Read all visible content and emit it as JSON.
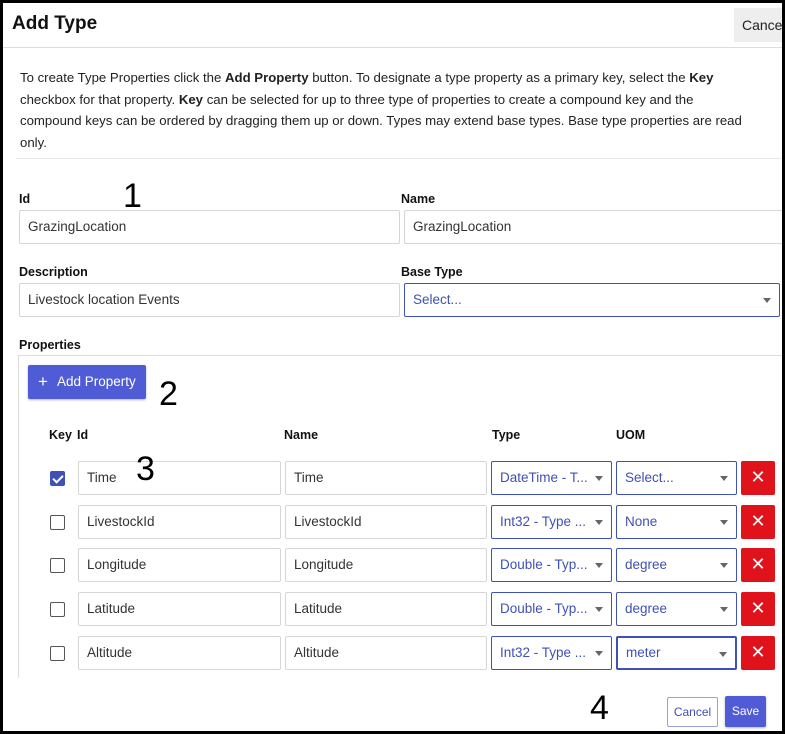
{
  "dialog": {
    "title": "Add Type",
    "cancel_top_label": "Cancel",
    "intro": {
      "p1": "To create Type Properties click the ",
      "b1": "Add Property",
      "p2": " button. To designate a type property as a primary key, select the ",
      "b2": "Key",
      "p3": " checkbox for that property. ",
      "b3": "Key",
      "p4": " can be selected for up to three type of properties to create a compound key and the compound keys can be ordered by dragging them up or down. Types may extend base types. Base type properties are read only."
    }
  },
  "form": {
    "id_label": "Id",
    "id_value": "GrazingLocation",
    "name_label": "Name",
    "name_value": "GrazingLocation",
    "description_label": "Description",
    "description_value": "Livestock location Events",
    "base_type_label": "Base Type",
    "base_type_value": "Select..."
  },
  "properties": {
    "section_label": "Properties",
    "add_button_label": "Add Property",
    "add_button_icon": "plus-icon",
    "columns": {
      "key": "Key",
      "id": "Id",
      "name": "Name",
      "type": "Type",
      "uom": "UOM"
    },
    "rows": [
      {
        "key": true,
        "id": "Time",
        "name": "Time",
        "type": "DateTime - T...",
        "uom": "Select..."
      },
      {
        "key": false,
        "id": "LivestockId",
        "name": "LivestockId",
        "type": "Int32 - Type ...",
        "uom": "None"
      },
      {
        "key": false,
        "id": "Longitude",
        "name": "Longitude",
        "type": "Double - Typ...",
        "uom": "degree"
      },
      {
        "key": false,
        "id": "Latitude",
        "name": "Latitude",
        "type": "Double - Typ...",
        "uom": "degree"
      },
      {
        "key": false,
        "id": "Altitude",
        "name": "Altitude",
        "type": "Int32 - Type ...",
        "uom": "meter"
      }
    ],
    "delete_icon": "close-icon"
  },
  "footer": {
    "cancel_label": "Cancel",
    "save_label": "Save"
  },
  "annotations": {
    "n1": "1",
    "n2": "2",
    "n3": "3",
    "n4": "4"
  },
  "colors": {
    "accent": "#3f51b5",
    "button": "#4f5cd6",
    "danger": "#e0121b"
  }
}
